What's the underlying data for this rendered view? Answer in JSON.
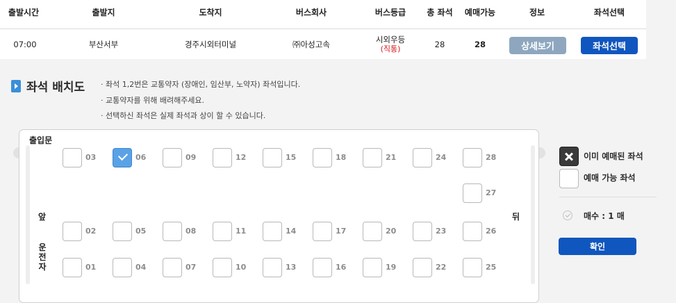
{
  "table": {
    "headers": [
      "출발시간",
      "출발지",
      "도착지",
      "버스회사",
      "버스등급",
      "총 좌석",
      "예매가능",
      "정보",
      "좌석선택"
    ],
    "row": {
      "time": "07:00",
      "from": "부산서부",
      "to": "경주시외터미널",
      "company": "㈜아성고속",
      "grade": "시외우등",
      "grade_sub": "(직통)",
      "total": "28",
      "available": "28",
      "detail_button": "상세보기",
      "select_button": "좌석선택"
    }
  },
  "seatmap": {
    "title": "좌석 배치도",
    "notes": [
      "좌석 1,2번은 교통약자 (장애인, 임산부, 노약자) 좌석입니다.",
      "교통약자를 위해 배려해주세요.",
      "선택하신 좌석은 실제 좌석과 상이 할 수 있습니다."
    ],
    "door_label": "출입문",
    "front_label": "앞",
    "back_label": "뒤",
    "driver_label": "운전자",
    "seats": [
      {
        "num": "03",
        "selected": false
      },
      {
        "num": "06",
        "selected": true
      },
      {
        "num": "09",
        "selected": false
      },
      {
        "num": "12",
        "selected": false
      },
      {
        "num": "15",
        "selected": false
      },
      {
        "num": "18",
        "selected": false
      },
      {
        "num": "21",
        "selected": false
      },
      {
        "num": "24",
        "selected": false
      },
      {
        "num": "28",
        "selected": false
      },
      {
        "num": "27",
        "selected": false
      },
      {
        "num": "02",
        "selected": false
      },
      {
        "num": "05",
        "selected": false
      },
      {
        "num": "08",
        "selected": false
      },
      {
        "num": "11",
        "selected": false
      },
      {
        "num": "14",
        "selected": false
      },
      {
        "num": "17",
        "selected": false
      },
      {
        "num": "20",
        "selected": false
      },
      {
        "num": "23",
        "selected": false
      },
      {
        "num": "26",
        "selected": false
      },
      {
        "num": "01",
        "selected": false
      },
      {
        "num": "04",
        "selected": false
      },
      {
        "num": "07",
        "selected": false
      },
      {
        "num": "10",
        "selected": false
      },
      {
        "num": "13",
        "selected": false
      },
      {
        "num": "16",
        "selected": false
      },
      {
        "num": "19",
        "selected": false
      },
      {
        "num": "22",
        "selected": false
      },
      {
        "num": "25",
        "selected": false
      }
    ]
  },
  "legend": {
    "booked_label": "이미 예매된 좌석",
    "available_label": "예매 가능 좌석",
    "count_label": "매수 : 1 매",
    "confirm_button": "확인"
  },
  "colors": {
    "primary_button": "#1056bf",
    "detail_button": "#8ea7bf",
    "selected_seat": "#5aa2e6",
    "grade_sub": "#d8191f"
  }
}
